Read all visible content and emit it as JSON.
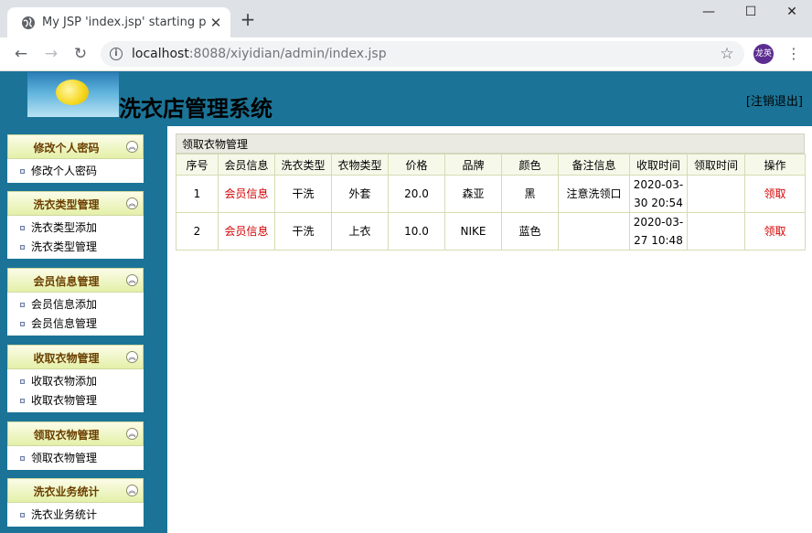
{
  "browser": {
    "tab_title": "My JSP 'index.jsp' starting page",
    "tab_close": "✕",
    "new_tab": "+",
    "url_host": "localhost",
    "url_rest": ":8088/xiyidian/admin/index.jsp",
    "profile_label": "龙英",
    "window_minimize": "—",
    "window_maximize": "☐",
    "window_close": "✕",
    "back": "←",
    "forward": "→",
    "reload": "↻",
    "star": "☆",
    "menu": "⋮"
  },
  "header": {
    "title": "洗衣店管理系统",
    "logout_label": "[注销退出]"
  },
  "sidebar": {
    "groups": [
      {
        "title": "修改个人密码",
        "items": [
          "修改个人密码"
        ]
      },
      {
        "title": "洗衣类型管理",
        "items": [
          "洗衣类型添加",
          "洗衣类型管理"
        ]
      },
      {
        "title": "会员信息管理",
        "items": [
          "会员信息添加",
          "会员信息管理"
        ]
      },
      {
        "title": "收取衣物管理",
        "items": [
          "收取衣物添加",
          "收取衣物管理"
        ]
      },
      {
        "title": "领取衣物管理",
        "items": [
          "领取衣物管理"
        ]
      },
      {
        "title": "洗衣业务统计",
        "items": [
          "洗衣业务统计"
        ]
      }
    ]
  },
  "main": {
    "panel_title": "领取衣物管理",
    "columns": [
      "序号",
      "会员信息",
      "洗衣类型",
      "衣物类型",
      "价格",
      "品牌",
      "颜色",
      "备注信息",
      "收取时间",
      "领取时间",
      "操作"
    ],
    "rows": [
      {
        "no": "1",
        "member": "会员信息",
        "wash_type": "干洗",
        "cloth_type": "外套",
        "price": "20.0",
        "brand": "森亚",
        "color": "黑",
        "remark": "注意洗领口",
        "receive_time": "2020-03-30 20:54",
        "pickup_time": "",
        "action": "领取"
      },
      {
        "no": "2",
        "member": "会员信息",
        "wash_type": "干洗",
        "cloth_type": "上衣",
        "price": "10.0",
        "brand": "NIKE",
        "color": "蓝色",
        "remark": "",
        "receive_time": "2020-03-27 10:48",
        "pickup_time": "",
        "action": "领取"
      }
    ]
  },
  "colors": {
    "header_bg": "#1b7497",
    "link_red": "#d40000",
    "menu_head_bg": "#e4f0a8"
  }
}
